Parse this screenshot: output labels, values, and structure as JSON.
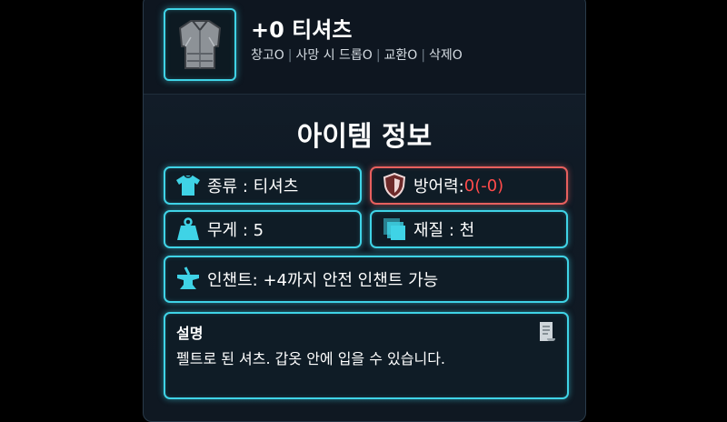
{
  "item": {
    "name": "+0 티셔츠",
    "icon": "tshirt-armor-icon",
    "tags": [
      "창고O",
      "사망 시 드롭O",
      "교환O",
      "삭제O"
    ]
  },
  "section_title": "아이템 정보",
  "stats": {
    "type": {
      "icon": "shirt-icon",
      "text": "종류 : 티셔츠"
    },
    "defense": {
      "icon": "shield-icon",
      "label": "방어력: ",
      "value": "0(-0)"
    },
    "weight": {
      "icon": "weight-icon",
      "text": "무게 : 5"
    },
    "material": {
      "icon": "material-icon",
      "text": "재질 : 천"
    },
    "enchant": {
      "icon": "anvil-icon",
      "text": "인챈트: +4까지 안전 인챈트 가능"
    }
  },
  "description": {
    "title": "설명",
    "text": "펠트로 된 셔츠. 갑옷 안에 입을 수 있습니다.",
    "icon": "scroll-icon"
  },
  "colors": {
    "accent": "#3fd3e6",
    "danger": "#e8605e",
    "danger_text": "#ff4b4b"
  }
}
